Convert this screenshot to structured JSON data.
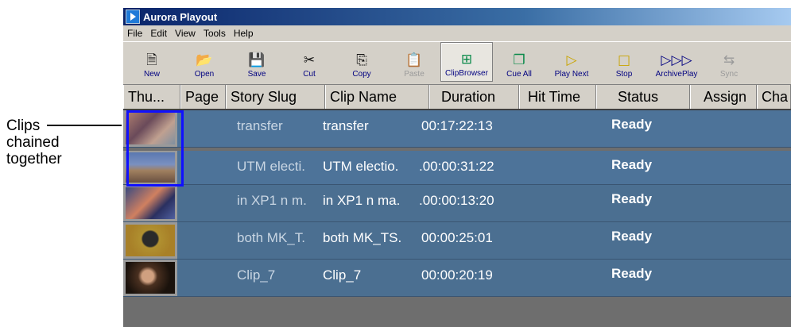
{
  "callout": {
    "text": "Clips\nchained\ntogether"
  },
  "window": {
    "title": "Aurora Playout"
  },
  "menu": [
    "File",
    "Edit",
    "View",
    "Tools",
    "Help"
  ],
  "toolbar": [
    {
      "label": "New",
      "icon": "new-document-icon",
      "glyph": "🗎"
    },
    {
      "label": "Open",
      "icon": "open-folder-icon",
      "glyph": "📂"
    },
    {
      "label": "Save",
      "icon": "floppy-disk-icon",
      "glyph": "💾"
    },
    {
      "label": "Cut",
      "icon": "scissors-icon",
      "glyph": "✂"
    },
    {
      "label": "Copy",
      "icon": "copy-icon",
      "glyph": "⎘"
    },
    {
      "label": "Paste",
      "icon": "paste-icon",
      "glyph": "📋"
    },
    {
      "label": "ClipBrowser",
      "icon": "clip-browser-icon",
      "glyph": "⊞"
    },
    {
      "label": "Cue All",
      "icon": "cue-all-icon",
      "glyph": "❐"
    },
    {
      "label": "Play Next",
      "icon": "play-next-icon",
      "glyph": "▷"
    },
    {
      "label": "Stop",
      "icon": "stop-icon",
      "glyph": "□"
    },
    {
      "label": "ArchivePlay",
      "icon": "archive-play-icon",
      "glyph": "▷▷▷"
    },
    {
      "label": "Sync",
      "icon": "sync-icon",
      "glyph": "⇆"
    }
  ],
  "columns": [
    "Thu...",
    "Page",
    "Story Slug",
    "Clip Name",
    "Duration",
    "Hit Time",
    "Status",
    "Assign",
    "Cha"
  ],
  "rows": [
    {
      "slug": "transfer",
      "clip": "transfer",
      "duration": "00:17:22:13",
      "status": "Ready"
    },
    {
      "slug": "UTM electi.",
      "clip": "UTM electio.",
      "duration": ".00:00:31:22",
      "status": "Ready"
    },
    {
      "slug": "in XP1 n m.",
      "clip": "in XP1 n ma.",
      "duration": ".00:00:13:20",
      "status": "Ready"
    },
    {
      "slug": "both MK_T.",
      "clip": "both MK_TS.",
      "duration": "00:00:25:01",
      "status": "Ready"
    },
    {
      "slug": "Clip_7",
      "clip": "Clip_7",
      "duration": "00:00:20:19",
      "status": "Ready"
    }
  ],
  "colors": {
    "row": "#4b6f91",
    "chain_border": "#1010ff",
    "title_bar": "#0a246a"
  }
}
